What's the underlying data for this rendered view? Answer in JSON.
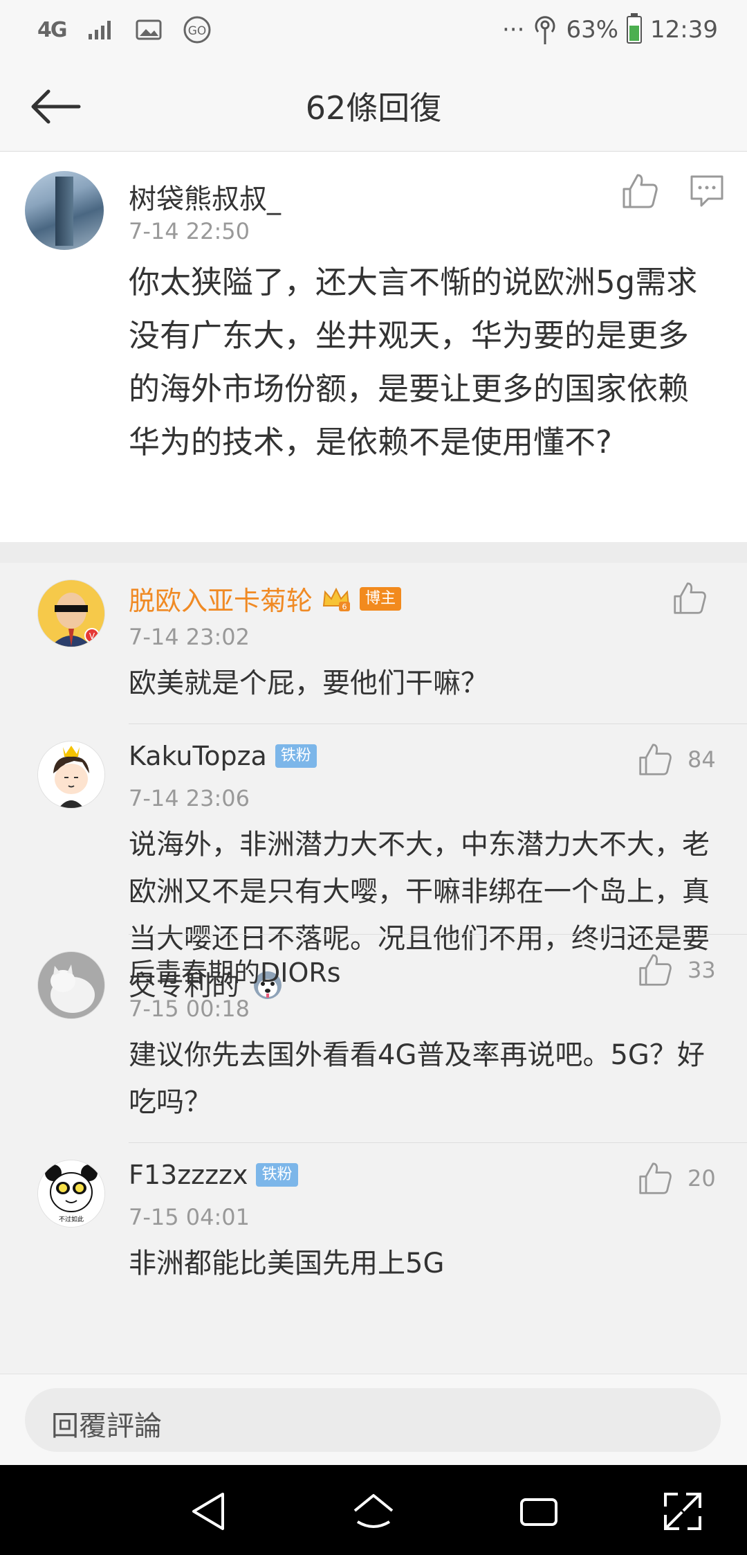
{
  "status_bar": {
    "network": "4G",
    "battery": "63%",
    "time": "12:39",
    "icons": [
      "signal-icon",
      "image-icon",
      "go-icon",
      "more-icon",
      "hotspot-icon",
      "battery-icon"
    ]
  },
  "header": {
    "title": "62條回復"
  },
  "main_post": {
    "author": "树袋熊叔叔_",
    "time": "7-14 22:50",
    "text": "你太狭隘了，还大言不惭的说欧洲5g需求没有广东大，坐井观天，华为要的是更多的海外市场份额，是要让更多的国家依赖华为的技术，是依赖不是使用懂不?"
  },
  "replies": [
    {
      "author": "脱欧入亚卡菊轮",
      "badge": "博主",
      "time": "7-14 23:02",
      "text": "欧美就是个屁，要他们干嘛？",
      "likes": ""
    },
    {
      "author": "KakuTopza",
      "badge": "铁粉",
      "time": "7-14 23:06",
      "text": "说海外，非洲潜力大不大，中东潜力大不大，老欧洲又不是只有大嘤，干嘛非绑在一个岛上，真当大嘤还日不落呢。况且他们不用，终归还是要交专利的",
      "likes": "84"
    },
    {
      "author": "后青春期的DIORs",
      "badge": "",
      "time": "7-15 00:18",
      "text": "建议你先去国外看看4G普及率再说吧。5G？好吃吗？",
      "likes": "33"
    },
    {
      "author": "F13zzzzx",
      "badge": "铁粉",
      "time": "7-15 04:01",
      "text": "非洲都能比美国先用上5G",
      "likes": "20"
    }
  ],
  "composer": {
    "placeholder": "回覆評論"
  },
  "colors": {
    "accent_orange": "#f08a24",
    "badge_blue": "#7cb6e9",
    "badge_orange": "#f28a1d"
  }
}
